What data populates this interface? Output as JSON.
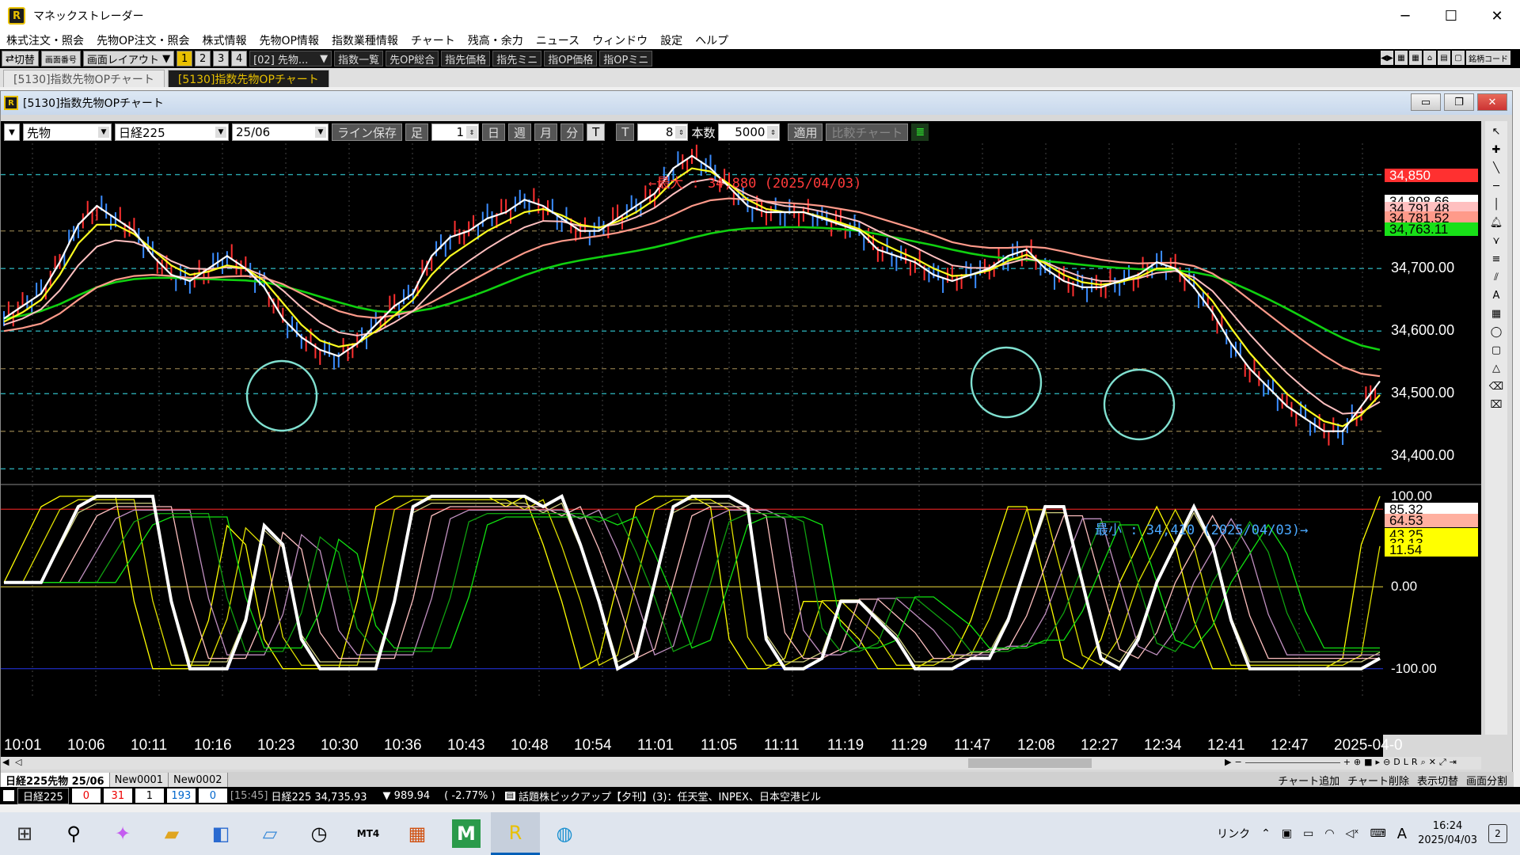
{
  "window": {
    "title": "マネックストレーダー",
    "controls": [
      "─",
      "☐",
      "✕"
    ]
  },
  "menu": [
    "株式注文・照会",
    "先物OP注文・照会",
    "株式情報",
    "先物OP情報",
    "指数業種情報",
    "チャート",
    "残高・余力",
    "ニュース",
    "ウィンドウ",
    "設定",
    "ヘルプ"
  ],
  "toolbar": {
    "switch_label": "切替",
    "screen_label": "画面番号",
    "layout_label": "画面レイアウト",
    "numbers": [
      "1",
      "2",
      "3",
      "4"
    ],
    "dropdown": "[02] 先物...",
    "buttons": [
      "指数一覧",
      "先OP総合",
      "指先価格",
      "指先ミニ",
      "指OP価格",
      "指OPミニ"
    ],
    "code_label": "銘柄コード"
  },
  "tabs": [
    "[5130]指数先物OPチャート",
    "[5130]指数先物OPチャート"
  ],
  "child": {
    "title": "[5130]指数先物OPチャート"
  },
  "chart_toolbar": {
    "type": "先物",
    "index": "日経225",
    "month": "25/06",
    "save_line": "ライン保存",
    "ashi": "足",
    "ashi_value": "1",
    "periods": [
      "日",
      "週",
      "月",
      "分",
      "T"
    ],
    "t_label": "T",
    "t_value": "8",
    "count_label": "本数",
    "count_value": "5000",
    "apply": "適用",
    "compare": "比較チャート"
  },
  "annotations": {
    "max": "←最大 : 34,880 (2025/04/03)",
    "min": "最小 : 34,410 (2025/04/03)→"
  },
  "price_labels": {
    "y_ticks": [
      "34,700.00",
      "34,600.00",
      "34,500.00",
      "34,400.00"
    ],
    "tags": [
      {
        "text": "34,850",
        "bg": "#ff3030",
        "fg": "#ffffff"
      },
      {
        "text": "34,808.66",
        "bg": "#ffffff",
        "fg": "#000000"
      },
      {
        "text": "34,791.48",
        "bg": "#ffc0c0",
        "fg": "#000000"
      },
      {
        "text": "34,781.52",
        "bg": "#ff9a8a",
        "fg": "#000000"
      },
      {
        "text": "34,763.11",
        "bg": "#18e018",
        "fg": "#000000"
      }
    ]
  },
  "osc_labels": {
    "y_ticks": [
      "100.00",
      "0.00",
      "-100.00"
    ],
    "tags": [
      {
        "text": "85.32",
        "bg": "#ffffff",
        "fg": "#000000"
      },
      {
        "text": "64.53",
        "bg": "#ffb0a0",
        "fg": "#000000"
      },
      {
        "text": "43.25",
        "bg": "#ffff00",
        "fg": "#000000"
      },
      {
        "text": "32.13",
        "bg": "#ffff00",
        "fg": "#000000"
      },
      {
        "text": "11.54",
        "bg": "#ffff00",
        "fg": "#000000"
      }
    ]
  },
  "time_axis": [
    "10:01",
    "10:06",
    "10:11",
    "10:16",
    "10:23",
    "10:30",
    "10:36",
    "10:43",
    "10:48",
    "10:54",
    "11:01",
    "11:05",
    "11:11",
    "11:19",
    "11:29",
    "11:47",
    "12:08",
    "12:27",
    "12:34",
    "12:41",
    "12:47",
    "2025-04-0"
  ],
  "sheet_tabs": [
    "日経225先物 25/06",
    "New0001",
    "New0002"
  ],
  "sheet_actions": [
    "チャート追加",
    "チャート削除",
    "表示切替",
    "画面分割"
  ],
  "ticker": {
    "name": "日経225",
    "counts": [
      "0",
      "31",
      "1",
      "193",
      "0"
    ],
    "time": "[15:45]",
    "quote": "日経225 34,735.93",
    "change": "▼ 989.94",
    "pct": "( -2.77% )",
    "news": "話題株ピックアップ【夕刊】(3)：任天堂、INPEX、日本空港ビル"
  },
  "taskbar": {
    "tray_link": "リンク",
    "ime": "A",
    "time": "16:24",
    "date": "2025/04/03",
    "notifications": "2"
  },
  "chart_data": {
    "type": "line",
    "price_range": [
      34360,
      34900
    ],
    "osc_range": [
      -115,
      110
    ],
    "series_price": {
      "close": [
        34620,
        34640,
        34660,
        34710,
        34770,
        34800,
        34780,
        34760,
        34720,
        34690,
        34680,
        34700,
        34720,
        34700,
        34670,
        34620,
        34590,
        34570,
        34560,
        34580,
        34610,
        34640,
        34660,
        34720,
        34750,
        34760,
        34780,
        34790,
        34810,
        34800,
        34780,
        34760,
        34760,
        34780,
        34800,
        34820,
        34860,
        34880,
        34860,
        34830,
        34800,
        34790,
        34790,
        34790,
        34780,
        34770,
        34760,
        34730,
        34720,
        34710,
        34690,
        34680,
        34690,
        34700,
        34720,
        34730,
        34700,
        34680,
        34670,
        34670,
        34680,
        34690,
        34710,
        34700,
        34670,
        34630,
        34580,
        34540,
        34510,
        34480,
        34460,
        34440,
        34440,
        34480,
        34520
      ],
      "ema_fast": [
        34615,
        34630,
        34650,
        34690,
        34740,
        34770,
        34770,
        34755,
        34730,
        34705,
        34690,
        34695,
        34705,
        34700,
        34680,
        34645,
        34610,
        34585,
        34575,
        34580,
        34600,
        34625,
        34650,
        34690,
        34720,
        34740,
        34760,
        34775,
        34790,
        34795,
        34785,
        34770,
        34765,
        34775,
        34790,
        34810,
        34840,
        34860,
        34855,
        34835,
        34810,
        34795,
        34790,
        34790,
        34782,
        34773,
        34763,
        34743,
        34729,
        34716,
        34700,
        34688,
        34690,
        34697,
        34712,
        34722,
        34708,
        34690,
        34678,
        34674,
        34678,
        34686,
        34700,
        34700,
        34680,
        34648,
        34605,
        34565,
        34532,
        34500,
        34476,
        34456,
        34448,
        34466,
        34498
      ],
      "ema_mid": [
        34610,
        34620,
        34635,
        34665,
        34705,
        34735,
        34745,
        34742,
        34730,
        34712,
        34700,
        34699,
        34702,
        34700,
        34688,
        34665,
        34638,
        34614,
        34598,
        34593,
        34598,
        34614,
        34632,
        34662,
        34690,
        34712,
        34732,
        34750,
        34766,
        34776,
        34775,
        34768,
        34766,
        34771,
        34782,
        34797,
        34819,
        34838,
        34843,
        34834,
        34818,
        34806,
        34800,
        34797,
        34791,
        34783,
        34775,
        34760,
        34747,
        34734,
        34719,
        34705,
        34701,
        34701,
        34708,
        34716,
        34710,
        34697,
        34686,
        34680,
        34680,
        34684,
        34693,
        34696,
        34686,
        34664,
        34630,
        34595,
        34563,
        34533,
        34507,
        34484,
        34468,
        34470,
        34487
      ],
      "ema_slow": [
        34600,
        34605,
        34612,
        34628,
        34650,
        34670,
        34682,
        34688,
        34690,
        34688,
        34685,
        34685,
        34687,
        34688,
        34685,
        34675,
        34660,
        34645,
        34632,
        34624,
        34621,
        34625,
        34632,
        34646,
        34662,
        34678,
        34694,
        34710,
        34725,
        34737,
        34744,
        34748,
        34752,
        34757,
        34764,
        34773,
        34786,
        34800,
        34809,
        34812,
        34810,
        34807,
        34805,
        34803,
        34800,
        34795,
        34790,
        34781,
        34772,
        34763,
        34753,
        34742,
        34736,
        34733,
        34733,
        34735,
        34733,
        34727,
        34720,
        34714,
        34710,
        34708,
        34709,
        34709,
        34704,
        34692,
        34673,
        34650,
        34627,
        34604,
        34582,
        34561,
        34543,
        34532,
        34528
      ],
      "ema_long": [
        34620,
        34625,
        34632,
        34643,
        34657,
        34670,
        34678,
        34683,
        34685,
        34685,
        34684,
        34683,
        34682,
        34681,
        34678,
        34672,
        34664,
        34655,
        34646,
        34638,
        34632,
        34630,
        34631,
        34636,
        34644,
        34654,
        34665,
        34677,
        34689,
        34699,
        34707,
        34713,
        34718,
        34723,
        34728,
        34734,
        34741,
        34749,
        34756,
        34761,
        34764,
        34765,
        34766,
        34766,
        34765,
        34763,
        34760,
        34755,
        34749,
        34743,
        34737,
        34730,
        34724,
        34719,
        34716,
        34714,
        34712,
        34709,
        34706,
        34703,
        34701,
        34699,
        34698,
        34697,
        34694,
        34688,
        34678,
        34665,
        34651,
        34636,
        34620,
        34604,
        34589,
        34577,
        34570
      ]
    }
  }
}
